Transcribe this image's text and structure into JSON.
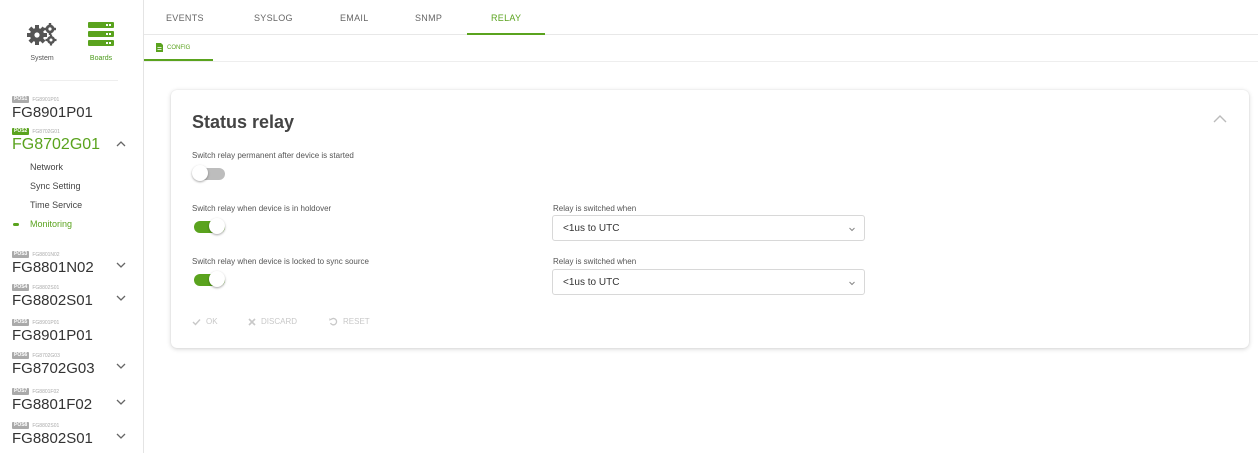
{
  "sidebar": {
    "tools": [
      {
        "label": "System",
        "icon": "gears-icon"
      },
      {
        "label": "Boards",
        "icon": "boards-icon"
      }
    ],
    "boards": [
      {
        "pos": "POS1",
        "code": "FG8901P01",
        "name": "FG8901P01"
      },
      {
        "pos": "POS2",
        "code": "FG8702G01",
        "name": "FG8702G01"
      },
      {
        "pos": "POS3",
        "code": "FG8801N02",
        "name": "FG8801N02"
      },
      {
        "pos": "POS4",
        "code": "FG8802S01",
        "name": "FG8802S01"
      },
      {
        "pos": "POS5",
        "code": "FG8901P01",
        "name": "FG8901P01"
      },
      {
        "pos": "POS6",
        "code": "FG8702G03",
        "name": "FG8702G03"
      },
      {
        "pos": "POS7",
        "code": "FG8801F02",
        "name": "FG8801F02"
      },
      {
        "pos": "POS8",
        "code": "FG8802S01",
        "name": "FG8802S01"
      }
    ],
    "submenu": [
      "Network",
      "Sync Setting",
      "Time Service",
      "Monitoring"
    ]
  },
  "tabs": [
    "EVENTS",
    "SYSLOG",
    "EMAIL",
    "SNMP",
    "RELAY"
  ],
  "active_tab": "RELAY",
  "subtab": "CONFIG",
  "card": {
    "title": "Status relay",
    "rows": [
      {
        "label": "Switch relay permanent after device is started",
        "on": false
      },
      {
        "label": "Switch relay when device is in holdover",
        "on": true,
        "select_label": "Relay is switched when",
        "select_value": "<1us to UTC"
      },
      {
        "label": "Switch relay when device is locked to sync source",
        "on": true,
        "select_label": "Relay is switched when",
        "select_value": "<1us to UTC"
      }
    ],
    "actions": {
      "ok": "OK",
      "discard": "DISCARD",
      "reset": "RESET"
    }
  },
  "colors": {
    "accent": "#5aa31e",
    "disabled": "#c8c8c8"
  }
}
